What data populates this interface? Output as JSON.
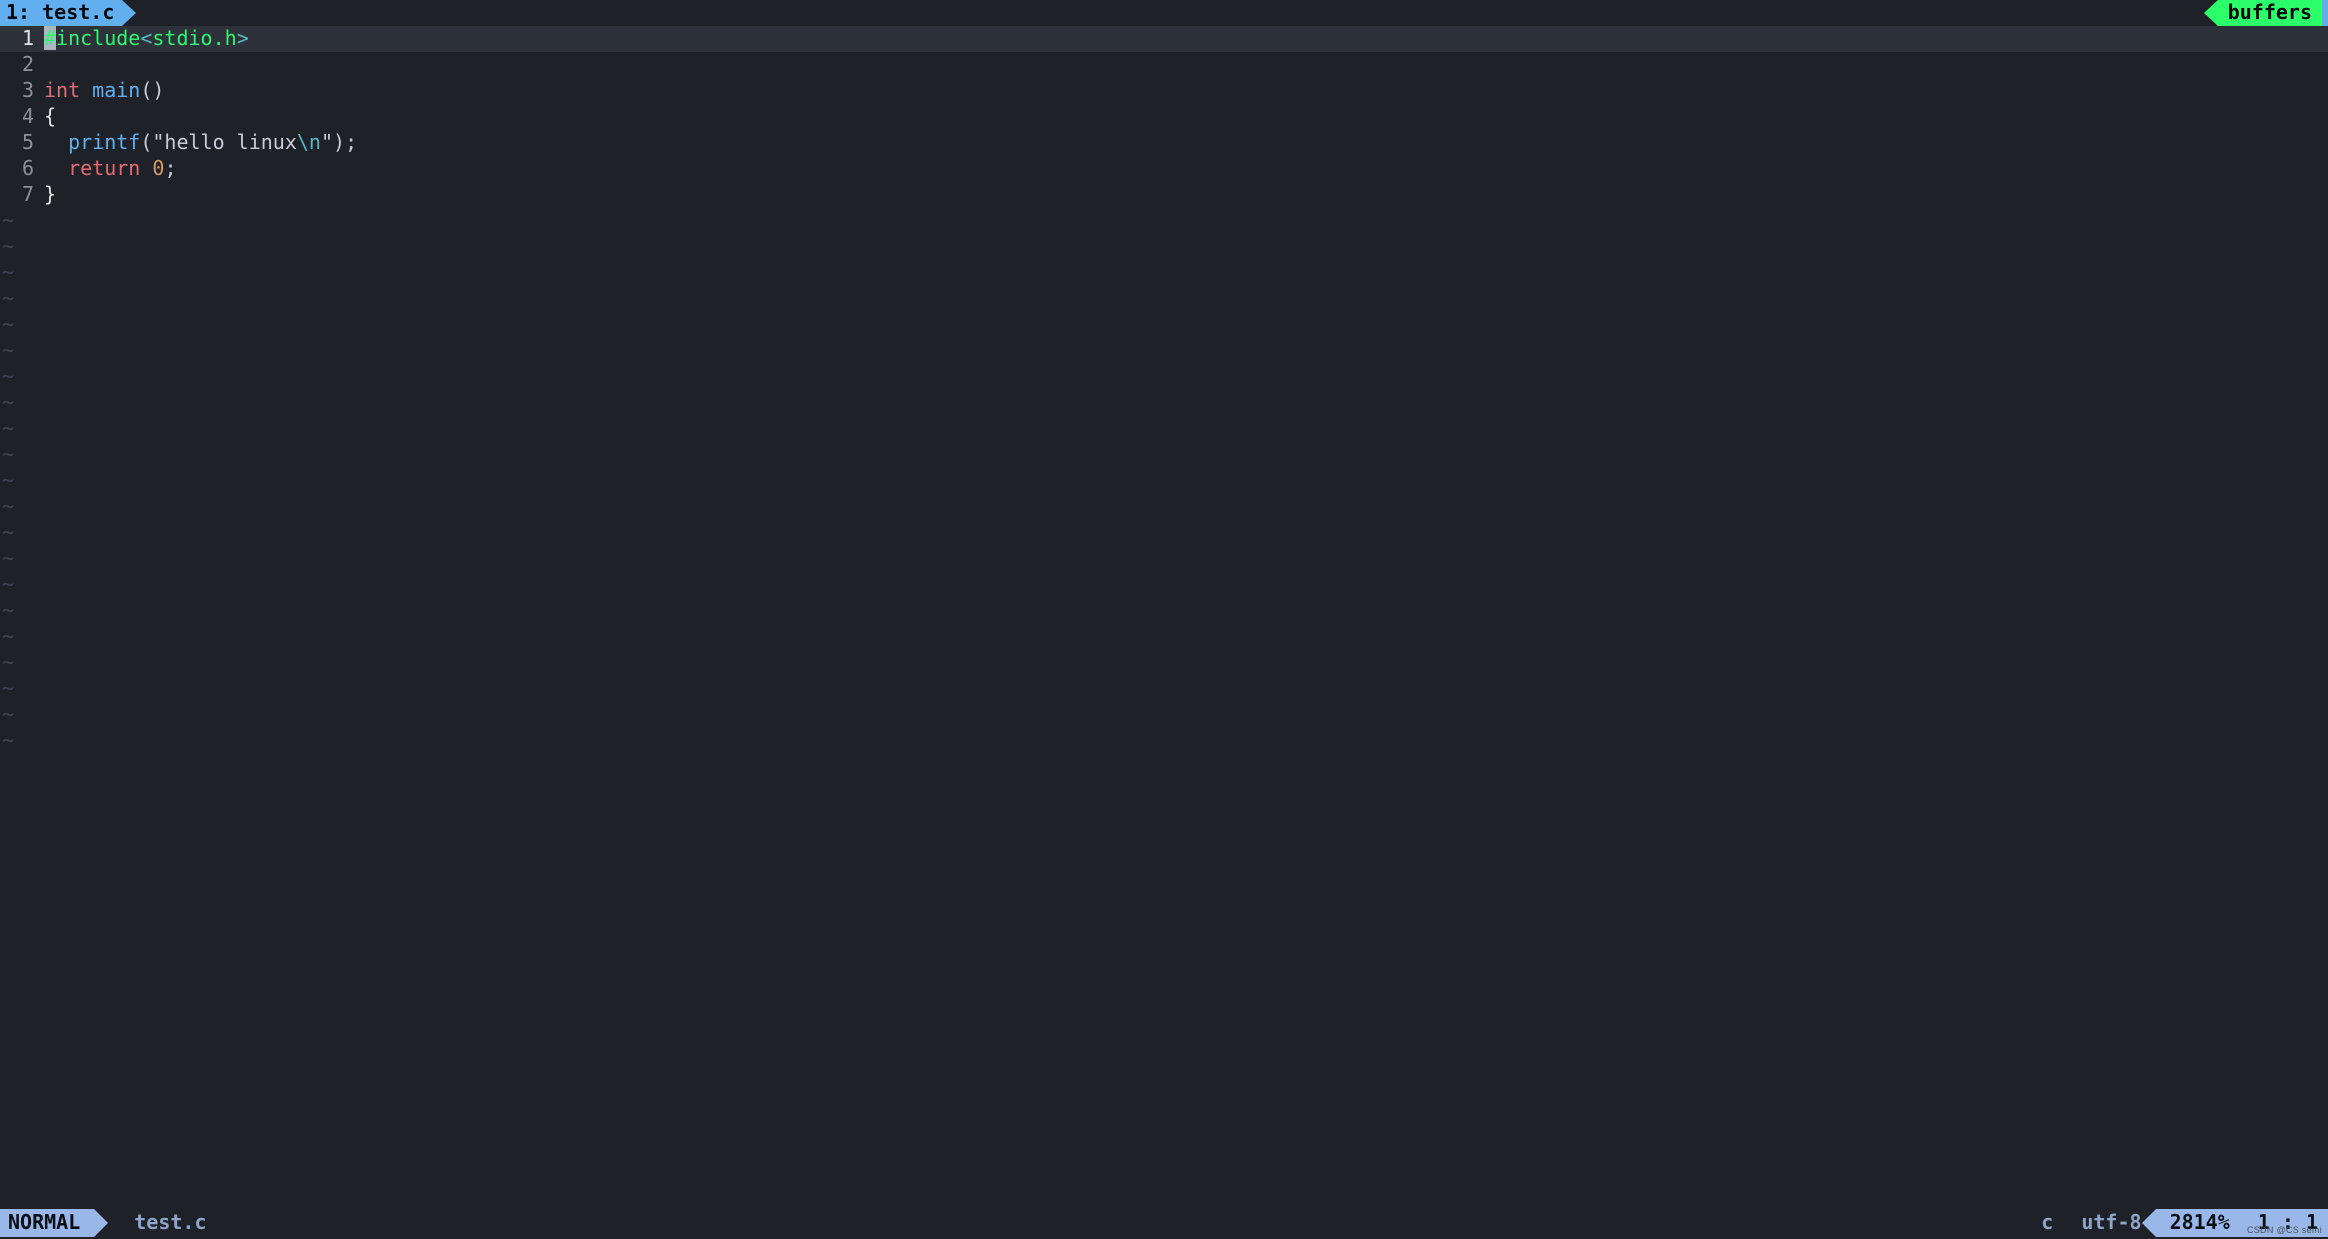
{
  "topbar": {
    "tab_label": "1: test.c",
    "buffers_label": "buffers"
  },
  "editor": {
    "tilde": "~",
    "lines": [
      {
        "n": "1",
        "current": true,
        "tokens": [
          {
            "cls": "tok-hash cursor",
            "t": "#"
          },
          {
            "cls": "tok-include",
            "t": "include"
          },
          {
            "cls": "tok-angle",
            "t": "<"
          },
          {
            "cls": "tok-includefile",
            "t": "stdio.h"
          },
          {
            "cls": "tok-angle",
            "t": ">"
          }
        ]
      },
      {
        "n": "2",
        "tokens": []
      },
      {
        "n": "3",
        "tokens": [
          {
            "cls": "tok-keyword",
            "t": "int"
          },
          {
            "cls": "",
            "t": " "
          },
          {
            "cls": "tok-func",
            "t": "main"
          },
          {
            "cls": "tok-punct",
            "t": "()"
          }
        ]
      },
      {
        "n": "4",
        "tokens": [
          {
            "cls": "tok-brace",
            "t": "{"
          }
        ]
      },
      {
        "n": "5",
        "tokens": [
          {
            "cls": "",
            "t": "  "
          },
          {
            "cls": "tok-func",
            "t": "printf"
          },
          {
            "cls": "tok-punct",
            "t": "("
          },
          {
            "cls": "tok-string",
            "t": "\"hello linux"
          },
          {
            "cls": "tok-escape",
            "t": "\\n"
          },
          {
            "cls": "tok-string",
            "t": "\""
          },
          {
            "cls": "tok-punct",
            "t": ");"
          }
        ]
      },
      {
        "n": "6",
        "tokens": [
          {
            "cls": "",
            "t": "  "
          },
          {
            "cls": "tok-keyword",
            "t": "return"
          },
          {
            "cls": "",
            "t": " "
          },
          {
            "cls": "tok-number",
            "t": "0"
          },
          {
            "cls": "tok-punct",
            "t": ";"
          }
        ]
      },
      {
        "n": "7",
        "tokens": [
          {
            "cls": "tok-brace",
            "t": "}"
          }
        ]
      }
    ],
    "tilde_count": 21
  },
  "status": {
    "mode": "NORMAL",
    "file": "test.c",
    "filetype": "c",
    "encoding": "utf-8",
    "percent": "2814%",
    "position": "1 :  1"
  },
  "watermark": "CSDN @CS semi"
}
